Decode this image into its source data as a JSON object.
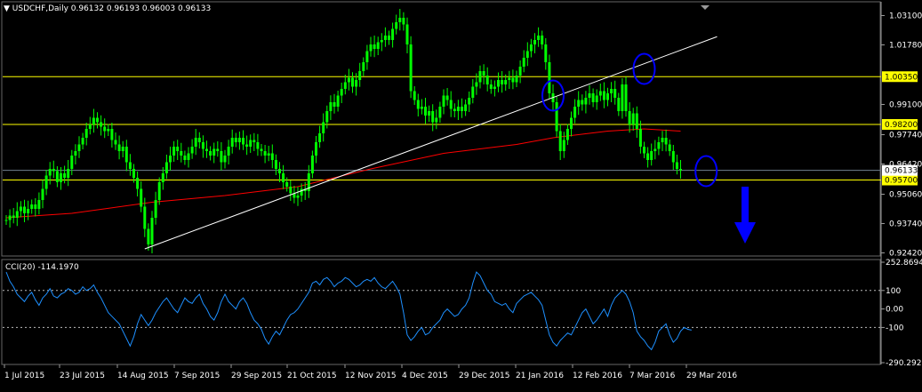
{
  "header": {
    "arrow_glyph": "▼",
    "symbol": "USDCHF,Daily",
    "ohlc": "0.96132 0.96193 0.96003 0.96133"
  },
  "cci_header": {
    "label": "CCI(20) -114.1970"
  },
  "colors": {
    "background": "#000000",
    "candles": "#00FF00",
    "ma": "#FF0000",
    "trendline": "#FFFFFF",
    "horizontal_lines": "#FFFF00",
    "current_price_line": "#708090",
    "cci": "#1E90FF",
    "ellipses": "#0000FF",
    "arrow": "#0000FF",
    "yellow_label_bg": "#FFFF00",
    "white_label_bg": "#FFFFFF",
    "grid_frame": "#FFFFFF"
  },
  "chart_data": [
    {
      "type": "line",
      "name": "price",
      "y_ticks": [
        "1.03100",
        "1.01780",
        "0.99100",
        "0.97740",
        "0.96420",
        "0.95060",
        "0.93740",
        "0.92420"
      ],
      "ylim": [
        0.9228,
        1.0356
      ],
      "x_tick_labels": [
        "1 Jul 2015",
        "23 Jul 2015",
        "14 Aug 2015",
        "7 Sep 2015",
        "29 Sep 2015",
        "21 Oct 2015",
        "12 Nov 2015",
        "4 Dec 2015",
        "29 Dec 2015",
        "21 Jan 2016",
        "12 Feb 2016",
        "7 Mar 2016",
        "29 Mar 2016"
      ],
      "closes": [
        0.939,
        0.941,
        0.94,
        0.943,
        0.945,
        0.942,
        0.944,
        0.946,
        0.944,
        0.948,
        0.953,
        0.959,
        0.962,
        0.961,
        0.956,
        0.96,
        0.958,
        0.962,
        0.968,
        0.97,
        0.973,
        0.976,
        0.98,
        0.982,
        0.985,
        0.983,
        0.981,
        0.979,
        0.98,
        0.975,
        0.973,
        0.97,
        0.972,
        0.965,
        0.962,
        0.958,
        0.953,
        0.945,
        0.935,
        0.928,
        0.94,
        0.948,
        0.956,
        0.96,
        0.965,
        0.968,
        0.972,
        0.97,
        0.968,
        0.966,
        0.969,
        0.972,
        0.976,
        0.974,
        0.971,
        0.97,
        0.968,
        0.971,
        0.97,
        0.965,
        0.968,
        0.972,
        0.976,
        0.974,
        0.976,
        0.973,
        0.972,
        0.975,
        0.974,
        0.971,
        0.97,
        0.968,
        0.969,
        0.966,
        0.962,
        0.96,
        0.956,
        0.954,
        0.951,
        0.949,
        0.95,
        0.953,
        0.952,
        0.96,
        0.968,
        0.974,
        0.978,
        0.983,
        0.988,
        0.992,
        0.99,
        0.995,
        0.998,
        1.001,
        1.003,
        0.999,
        1.002,
        1.006,
        1.01,
        1.015,
        1.018,
        1.016,
        1.019,
        1.02,
        1.022,
        1.02,
        1.025,
        1.028,
        1.03,
        1.027,
        1.018,
        0.997,
        0.993,
        0.989,
        0.99,
        0.986,
        0.988,
        0.983,
        0.985,
        0.99,
        0.995,
        0.993,
        0.989,
        0.988,
        0.99,
        0.988,
        0.991,
        0.994,
        0.999,
        1.001,
        1.006,
        1.004,
        1.0,
        0.998,
        0.999,
        1.002,
        1.0,
        1.002,
        1.003,
        1.001,
        1.004,
        1.008,
        1.012,
        1.015,
        1.018,
        1.02,
        1.022,
        1.018,
        1.01,
        0.996,
        0.992,
        0.979,
        0.97,
        0.975,
        0.98,
        0.985,
        0.99,
        0.993,
        0.991,
        0.994,
        0.996,
        0.992,
        0.995,
        0.997,
        0.993,
        0.996,
        0.998,
        0.994,
        0.988,
        1.0,
        0.988,
        0.982,
        0.987,
        0.98,
        0.972,
        0.969,
        0.966,
        0.97,
        0.971,
        0.974,
        0.976,
        0.973,
        0.97,
        0.965,
        0.962,
        0.9613
      ],
      "moving_average": {
        "start_value": 0.94,
        "end_value": 0.98,
        "points": [
          [
            0,
            0.94
          ],
          [
            18,
            0.942
          ],
          [
            40,
            0.947
          ],
          [
            60,
            0.95
          ],
          [
            80,
            0.954
          ],
          [
            100,
            0.962
          ],
          [
            120,
            0.969
          ],
          [
            140,
            0.973
          ],
          [
            150,
            0.976
          ],
          [
            165,
            0.979
          ],
          [
            175,
            0.98
          ],
          [
            185,
            0.979
          ]
        ]
      },
      "trendline": {
        "from": [
          38,
          0.926
        ],
        "to": [
          195,
          1.0215
        ]
      },
      "horizontal_levels": [
        {
          "value": 1.0035,
          "label": "1.00350",
          "color": "#FFFF00"
        },
        {
          "value": 0.982,
          "label": "0.98200",
          "color": "#FFFF00"
        },
        {
          "value": 0.957,
          "label": "0.95700",
          "color": "#FFFF00"
        }
      ],
      "current_price": {
        "value": 0.96133,
        "label": "0.96133"
      },
      "annotations": [
        {
          "kind": "ellipse",
          "bar": 150,
          "value": 0.995
        },
        {
          "kind": "ellipse",
          "bar": 175,
          "value": 1.007
        },
        {
          "kind": "ellipse",
          "bar": 192,
          "value": 0.961
        },
        {
          "kind": "arrow-down",
          "direction": "down"
        }
      ]
    },
    {
      "type": "line",
      "name": "CCI(20)",
      "ylim": [
        -290.2926,
        252.8694
      ],
      "y_ticks": [
        "252.8694",
        "100",
        "0.00",
        "-100",
        "-290.2926"
      ],
      "reference_levels": [
        100,
        -100
      ],
      "values": [
        200,
        150,
        120,
        80,
        60,
        40,
        70,
        90,
        50,
        20,
        60,
        80,
        110,
        70,
        60,
        80,
        90,
        110,
        100,
        80,
        90,
        120,
        100,
        110,
        130,
        90,
        60,
        20,
        -20,
        -40,
        -60,
        -80,
        -120,
        -160,
        -200,
        -150,
        -80,
        -30,
        -60,
        -90,
        -60,
        -20,
        10,
        40,
        60,
        30,
        0,
        -20,
        20,
        60,
        40,
        30,
        60,
        80,
        30,
        0,
        -40,
        -60,
        -20,
        40,
        80,
        40,
        20,
        0,
        40,
        60,
        30,
        -20,
        -60,
        -80,
        -110,
        -160,
        -190,
        -150,
        -120,
        -140,
        -100,
        -60,
        -30,
        -20,
        0,
        30,
        60,
        90,
        140,
        150,
        130,
        160,
        170,
        150,
        120,
        140,
        150,
        170,
        160,
        140,
        120,
        130,
        150,
        160,
        150,
        170,
        140,
        120,
        110,
        130,
        150,
        120,
        80,
        -20,
        -140,
        -170,
        -150,
        -120,
        -100,
        -140,
        -130,
        -100,
        -80,
        -60,
        -20,
        0,
        -20,
        -40,
        -30,
        0,
        20,
        60,
        140,
        200,
        180,
        140,
        100,
        80,
        40,
        30,
        20,
        30,
        0,
        -20,
        30,
        50,
        70,
        80,
        90,
        70,
        50,
        20,
        -60,
        -140,
        -180,
        -200,
        -170,
        -150,
        -130,
        -140,
        -100,
        -60,
        -20,
        0,
        -40,
        -80,
        -60,
        -30,
        0,
        -40,
        20,
        60,
        80,
        100,
        80,
        40,
        -20,
        -120,
        -150,
        -170,
        -200,
        -220,
        -180,
        -120,
        -100,
        -80,
        -140,
        -180,
        -160,
        -120,
        -100,
        -110,
        -114
      ]
    }
  ]
}
